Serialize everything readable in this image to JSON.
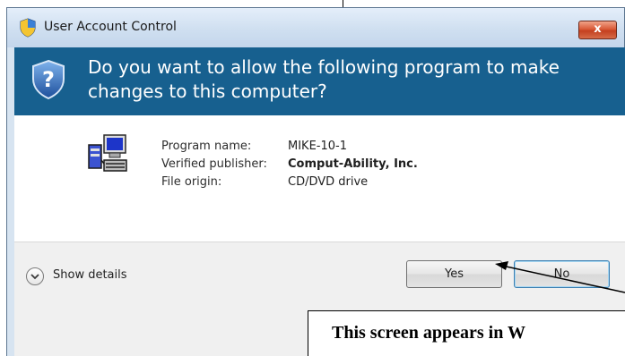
{
  "window": {
    "title": "User Account Control",
    "close_glyph": "x",
    "title_icon": "uac-shield-icon"
  },
  "header": {
    "question": "Do you want to allow the following program to make changes to this computer?",
    "icon": "uac-question-shield-icon",
    "band_color": "#17608f"
  },
  "program": {
    "icon": "program-installer-icon",
    "rows": [
      {
        "label": "Program name:",
        "value": "MIKE-10-1"
      },
      {
        "label": "Verified publisher:",
        "value": "Comput-Ability, Inc."
      },
      {
        "label": "File origin:",
        "value": "CD/DVD drive"
      }
    ]
  },
  "footer": {
    "details_label": "Show details",
    "yes_label": "Yes",
    "no_label": "No"
  },
  "annotation": {
    "caption": "This screen appears in W"
  }
}
